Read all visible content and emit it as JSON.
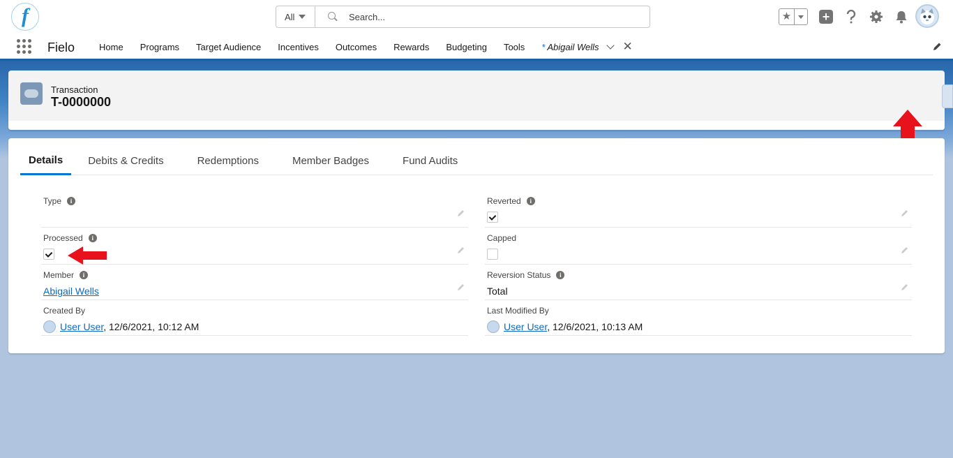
{
  "header": {
    "logo_letter": "f",
    "search": {
      "scope": "All",
      "placeholder": "Search..."
    },
    "icons": [
      "favorites-star-icon",
      "add-icon",
      "help-icon",
      "setup-gear-icon",
      "notifications-bell-icon",
      "user-avatar"
    ]
  },
  "nav": {
    "app_name": "Fielo",
    "items": [
      "Home",
      "Programs",
      "Target Audience",
      "Incentives",
      "Outcomes",
      "Rewards",
      "Budgeting",
      "Tools"
    ],
    "active_tab": {
      "marker": "*",
      "label": "Abigail Wells"
    }
  },
  "record": {
    "entity": "Transaction",
    "name": "T-0000000"
  },
  "tabs": [
    "Details",
    "Debits & Credits",
    "Redemptions",
    "Member Badges",
    "Fund Audits"
  ],
  "fields": {
    "type": {
      "label": "Type",
      "value": ""
    },
    "reverted": {
      "label": "Reverted",
      "checked": true
    },
    "processed": {
      "label": "Processed",
      "checked": true
    },
    "capped": {
      "label": "Capped",
      "checked": false
    },
    "member": {
      "label": "Member",
      "value": "Abigail Wells"
    },
    "reversion_status": {
      "label": "Reversion Status",
      "value": "Total"
    },
    "created_by": {
      "label": "Created By",
      "user": "User User",
      "date": ", 12/6/2021, 10:12 AM"
    },
    "last_modified_by": {
      "label": "Last Modified By",
      "user": "User User",
      "date": ", 12/6/2021, 10:13 AM"
    }
  },
  "colors": {
    "brand": "#0176d3",
    "annotation_arrow": "#e8121c",
    "nav_underline": "#1b5fa4"
  }
}
